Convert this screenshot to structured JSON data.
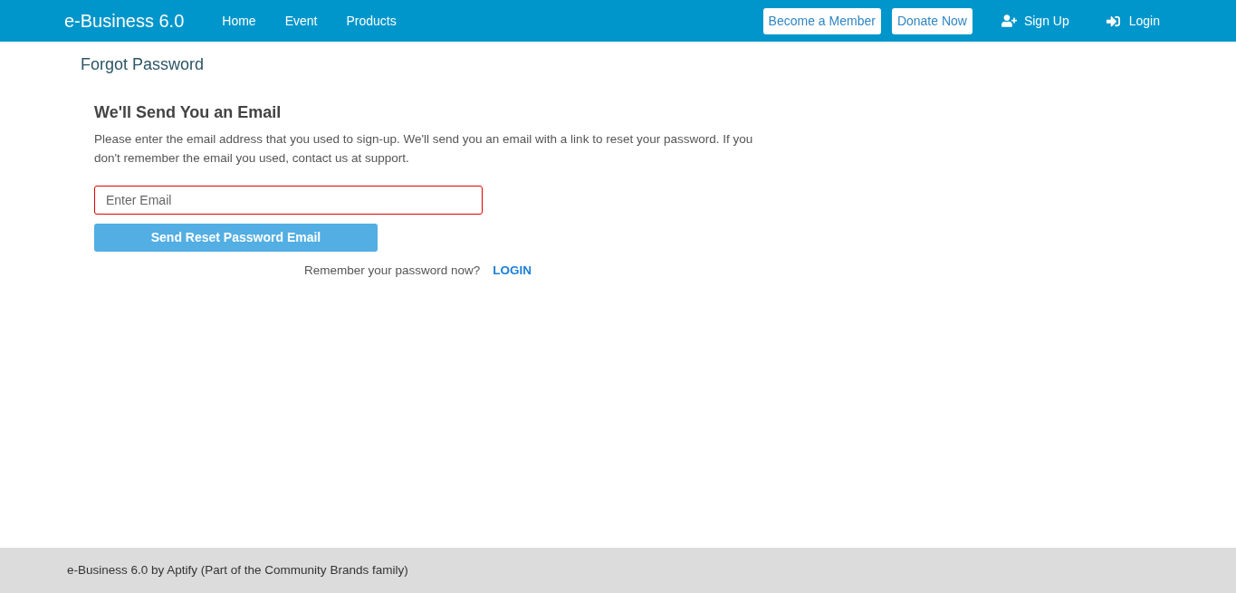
{
  "header": {
    "logo": "e-Business 6.0",
    "nav": [
      {
        "label": "Home"
      },
      {
        "label": "Event"
      },
      {
        "label": "Products"
      }
    ],
    "actions": [
      {
        "kind": "button",
        "label": "Become a Member"
      },
      {
        "kind": "button",
        "label": "Donate Now"
      },
      {
        "kind": "signup",
        "label": "Sign Up"
      },
      {
        "kind": "login",
        "label": "Login"
      }
    ]
  },
  "page_title": "Forgot Password",
  "form": {
    "heading": "We'll Send You an Email",
    "description": "Please enter the email address that you used to sign-up. We'll send you an email with a link to reset your password. If you don't remember the email you used, contact us at support.",
    "email_field": {
      "placeholder": "Enter Email",
      "invalid": true
    },
    "submit_button": "Send Reset Password Email",
    "login_prompt": {
      "text": "Remember your password now?",
      "link": "LOGIN"
    }
  },
  "footer": {
    "text": "e-Business 6.0 by Aptify (Part of the Community Brands family)"
  }
}
